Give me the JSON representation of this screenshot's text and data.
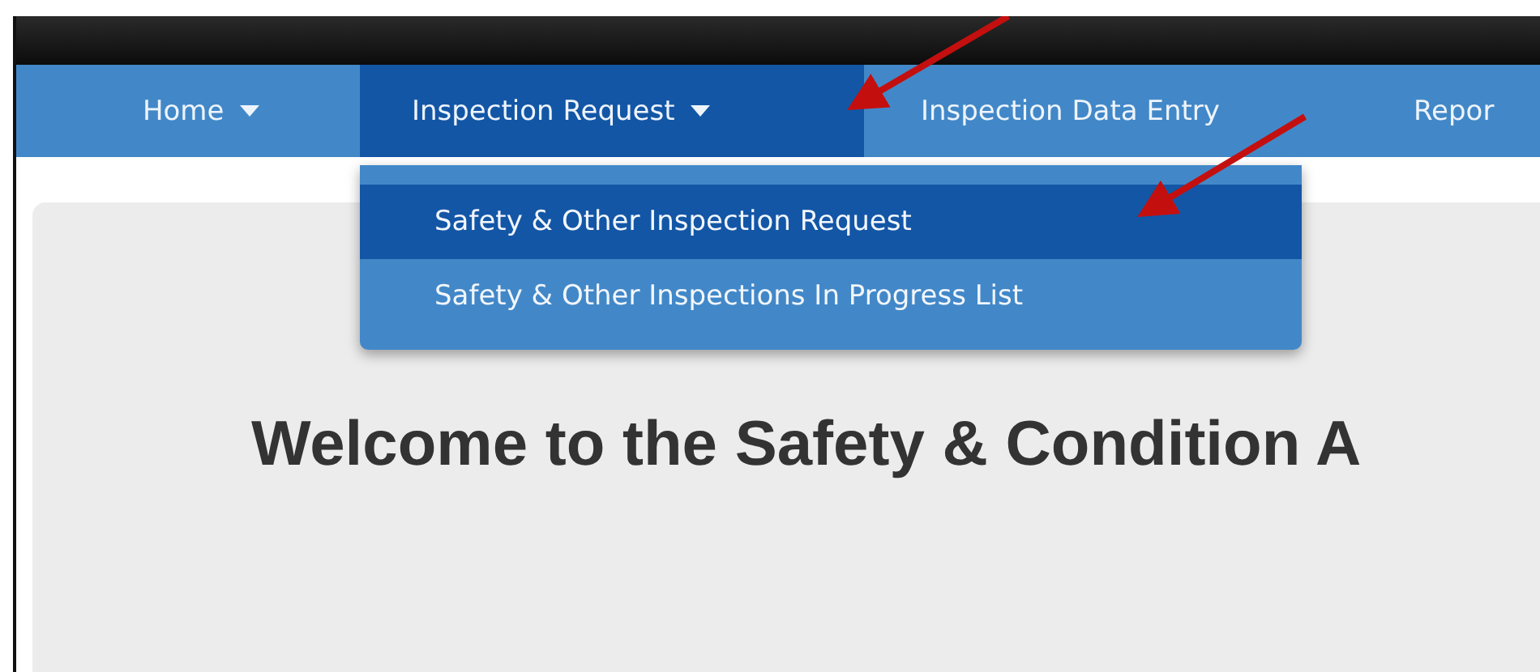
{
  "nav": {
    "items": [
      {
        "label": "Home",
        "has_caret": true,
        "selected": false
      },
      {
        "label": "Inspection Request",
        "has_caret": true,
        "selected": true
      },
      {
        "label": "Inspection Data Entry",
        "has_caret": false,
        "selected": false
      },
      {
        "label": "Repor",
        "has_caret": false,
        "selected": false
      }
    ]
  },
  "dropdown": {
    "items": [
      {
        "label": "Safety & Other Inspection Request",
        "selected": true
      },
      {
        "label": "Safety & Other Inspections In Progress List",
        "selected": false
      }
    ]
  },
  "heading": "Welcome to the Safety & Condition A"
}
